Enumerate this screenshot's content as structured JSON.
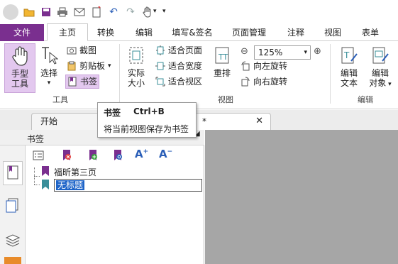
{
  "ribbon_tabs": {
    "file": "文件",
    "home": "主页",
    "convert": "转换",
    "edit": "编辑",
    "fill_sign": "填写&签名",
    "page_manage": "页面管理",
    "comment": "注释",
    "view": "视图",
    "form": "表单"
  },
  "tools_group": {
    "hand": "手型\n工具",
    "hand_line1": "手型",
    "hand_line2": "工具",
    "select": "选择",
    "snapshot": "截图",
    "clipboard": "剪贴板",
    "bookmark": "书签",
    "label": "工具"
  },
  "view_group": {
    "actual_line1": "实际",
    "actual_line2": "大小",
    "fit_page": "适合页面",
    "fit_width": "适合宽度",
    "fit_visible": "适合视区",
    "reflow": "重排",
    "zoom": "125%",
    "rotate_left": "向左旋转",
    "rotate_right": "向右旋转",
    "label": "视图"
  },
  "edit_group": {
    "edit_text_line1": "编辑",
    "edit_text_line2": "文本",
    "edit_obj_line1": "编辑",
    "edit_obj_line2": "对象",
    "label": "编辑"
  },
  "doc_tabs": {
    "start": "开始",
    "doc_marker": "*"
  },
  "bookmark_panel": {
    "title": "书签",
    "items": [
      {
        "label": "福昕第三页"
      },
      {
        "label": "无标题"
      }
    ]
  },
  "tooltip": {
    "title": "书签",
    "shortcut": "Ctrl+B",
    "description": "将当前视图保存为书签"
  },
  "colors": {
    "accent": "#7a2f8f",
    "hand_button_bg": "#e3c8ef",
    "selection": "#1e64c8",
    "doc_background": "#a6a6a6"
  }
}
